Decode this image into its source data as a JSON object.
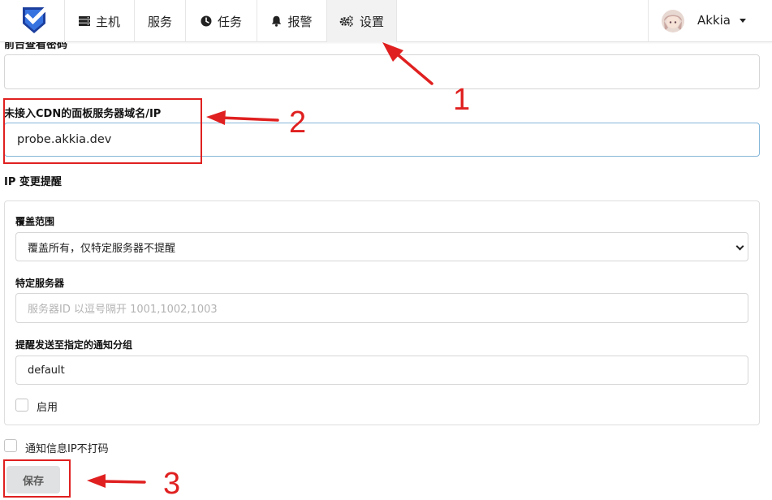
{
  "nav": {
    "items": [
      {
        "label": "主机",
        "icon": "server-icon"
      },
      {
        "label": "服务",
        "icon": ""
      },
      {
        "label": "任务",
        "icon": "clock-icon"
      },
      {
        "label": "报警",
        "icon": "bell-icon"
      },
      {
        "label": "设置",
        "icon": "gears-icon"
      }
    ],
    "active_index": 4,
    "user_name": "Akkia"
  },
  "form": {
    "prev_field_label": "前台查看密码",
    "prev_field_value": "",
    "domain_label": "未接入CDN的面板服务器域名/IP",
    "domain_value": "probe.akkia.dev",
    "ip_change_heading": "IP 变更提醒",
    "coverage_label": "覆盖范围",
    "coverage_selected": "覆盖所有，仅特定服务器不提醒",
    "specific_label": "特定服务器",
    "specific_placeholder": "服务器ID 以逗号隔开 1001,1002,1003",
    "notify_group_label": "提醒发送至指定的通知分组",
    "notify_group_value": "default",
    "enable_label": "启用",
    "enable_checked": false,
    "mask_ip_label": "通知信息IP不打码",
    "mask_ip_checked": false,
    "save_label": "保存"
  },
  "annotations": {
    "color": "#e02020",
    "numbers": [
      "1",
      "2",
      "3"
    ]
  }
}
